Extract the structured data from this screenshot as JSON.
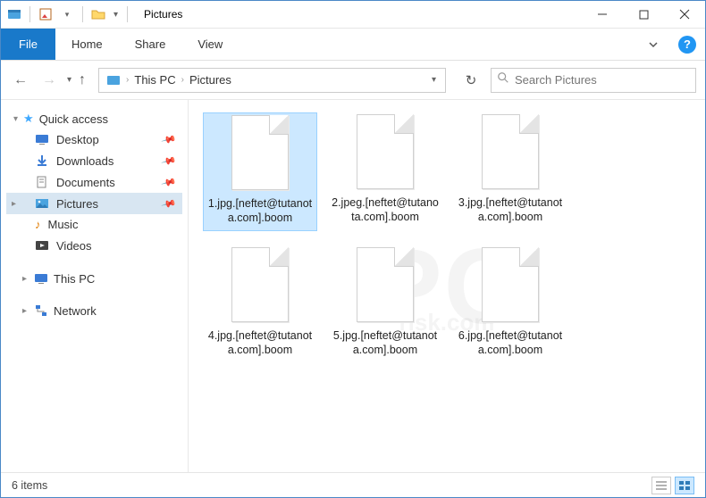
{
  "window": {
    "title": "Pictures"
  },
  "ribbon": {
    "file": "File",
    "tabs": [
      "Home",
      "Share",
      "View"
    ]
  },
  "breadcrumbs": [
    "This PC",
    "Pictures"
  ],
  "search": {
    "placeholder": "Search Pictures"
  },
  "sidebar": {
    "quick_access": "Quick access",
    "items": [
      {
        "label": "Desktop"
      },
      {
        "label": "Downloads"
      },
      {
        "label": "Documents"
      },
      {
        "label": "Pictures",
        "selected": true
      },
      {
        "label": "Music"
      },
      {
        "label": "Videos"
      }
    ],
    "this_pc": "This PC",
    "network": "Network"
  },
  "files": [
    {
      "name": "1.jpg.[neftet@tutanota.com].boom",
      "selected": true
    },
    {
      "name": "2.jpeg.[neftet@tutanota.com].boom"
    },
    {
      "name": "3.jpg.[neftet@tutanota.com].boom"
    },
    {
      "name": "4.jpg.[neftet@tutanota.com].boom"
    },
    {
      "name": "5.jpg.[neftet@tutanota.com].boom"
    },
    {
      "name": "6.jpg.[neftet@tutanota.com].boom"
    }
  ],
  "statusbar": {
    "count": "6 items"
  },
  "watermark": {
    "big": "PC",
    "small": "risk.com"
  }
}
